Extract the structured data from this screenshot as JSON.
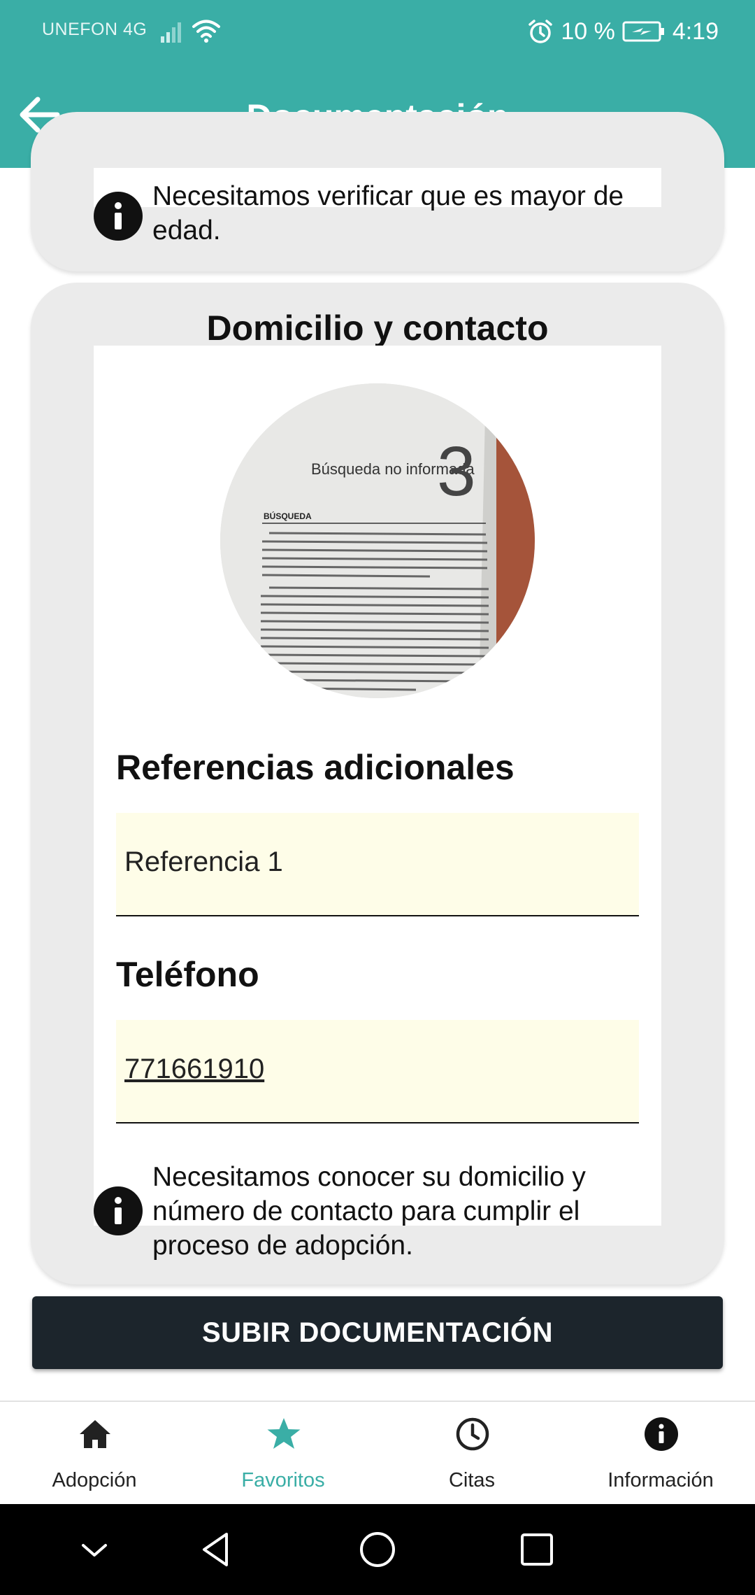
{
  "status_bar": {
    "carrier": "UNEFON 4G",
    "battery": "10 %",
    "time": "4:19"
  },
  "app_bar": {
    "title": "Documentación",
    "back_icon": "arrow-back-icon"
  },
  "age_card": {
    "info_text": "Necesitamos verificar que es mayor de edad."
  },
  "address_card": {
    "title": "Domicilio y contacto",
    "photo_title": "Búsqueda no informada",
    "photo_section": "BÚSQUEDA",
    "photo_number": "3",
    "references_label": "Referencias adicionales",
    "references_value": "Referencia 1",
    "phone_label": "Teléfono",
    "phone_value": "771661910",
    "info_text": "Necesitamos conocer su domicilio y número de contacto para cumplir el proceso de adopción."
  },
  "submit_button": "SUBIR DOCUMENTACIÓN",
  "bottom_nav": {
    "active": "favoritos",
    "items": [
      {
        "label": "Adopción",
        "icon": "home-icon"
      },
      {
        "label": "Favoritos",
        "icon": "star-icon"
      },
      {
        "label": "Citas",
        "icon": "clock-icon"
      },
      {
        "label": "Información",
        "icon": "info-icon"
      }
    ]
  },
  "system_nav": {
    "icons": [
      "chevron-down-icon",
      "back-triangle-icon",
      "home-circle-icon",
      "recents-square-icon"
    ]
  },
  "colors": {
    "primary": "#3aaea6",
    "button": "#1c252c",
    "field_background": "#fefde8",
    "card_background": "#ebebeb"
  }
}
